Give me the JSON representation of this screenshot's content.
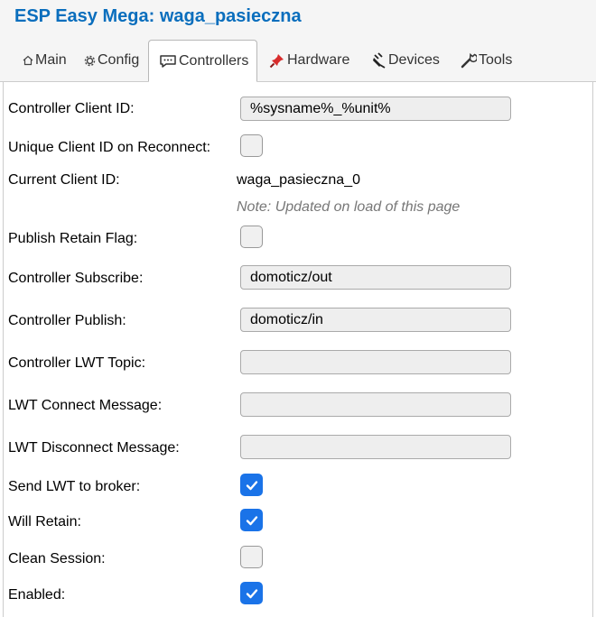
{
  "app": {
    "title": "ESP Easy Mega: waga_pasieczna"
  },
  "tabs": [
    {
      "label": "Main",
      "icon": "home-icon"
    },
    {
      "label": "Config",
      "icon": "gear-icon"
    },
    {
      "label": "Controllers",
      "icon": "chat-icon",
      "active": true
    },
    {
      "label": "Hardware",
      "icon": "pushpin-icon"
    },
    {
      "label": "Devices",
      "icon": "plug-icon"
    },
    {
      "label": "Tools",
      "icon": "wrench-icon"
    }
  ],
  "form": {
    "client_id": {
      "label": "Controller Client ID:",
      "value": "%sysname%_%unit%"
    },
    "unique_client_id": {
      "label": "Unique Client ID on Reconnect:",
      "checked": false
    },
    "current_client_id": {
      "label": "Current Client ID:",
      "value": "waga_pasieczna_0",
      "note": "Note: Updated on load of this page"
    },
    "publish_retain": {
      "label": "Publish Retain Flag:",
      "checked": false
    },
    "subscribe": {
      "label": "Controller Subscribe:",
      "value": "domoticz/out"
    },
    "publish": {
      "label": "Controller Publish:",
      "value": "domoticz/in"
    },
    "lwt_topic": {
      "label": "Controller LWT Topic:",
      "value": ""
    },
    "lwt_connect": {
      "label": "LWT Connect Message:",
      "value": ""
    },
    "lwt_disconnect": {
      "label": "LWT Disconnect Message:",
      "value": ""
    },
    "send_lwt": {
      "label": "Send LWT to broker:",
      "checked": true
    },
    "will_retain": {
      "label": "Will Retain:",
      "checked": true
    },
    "clean_session": {
      "label": "Clean Session:",
      "checked": false
    },
    "enabled": {
      "label": "Enabled:",
      "checked": true
    }
  },
  "colors": {
    "accent": "#1a73e8",
    "title": "#0a6ebd"
  }
}
